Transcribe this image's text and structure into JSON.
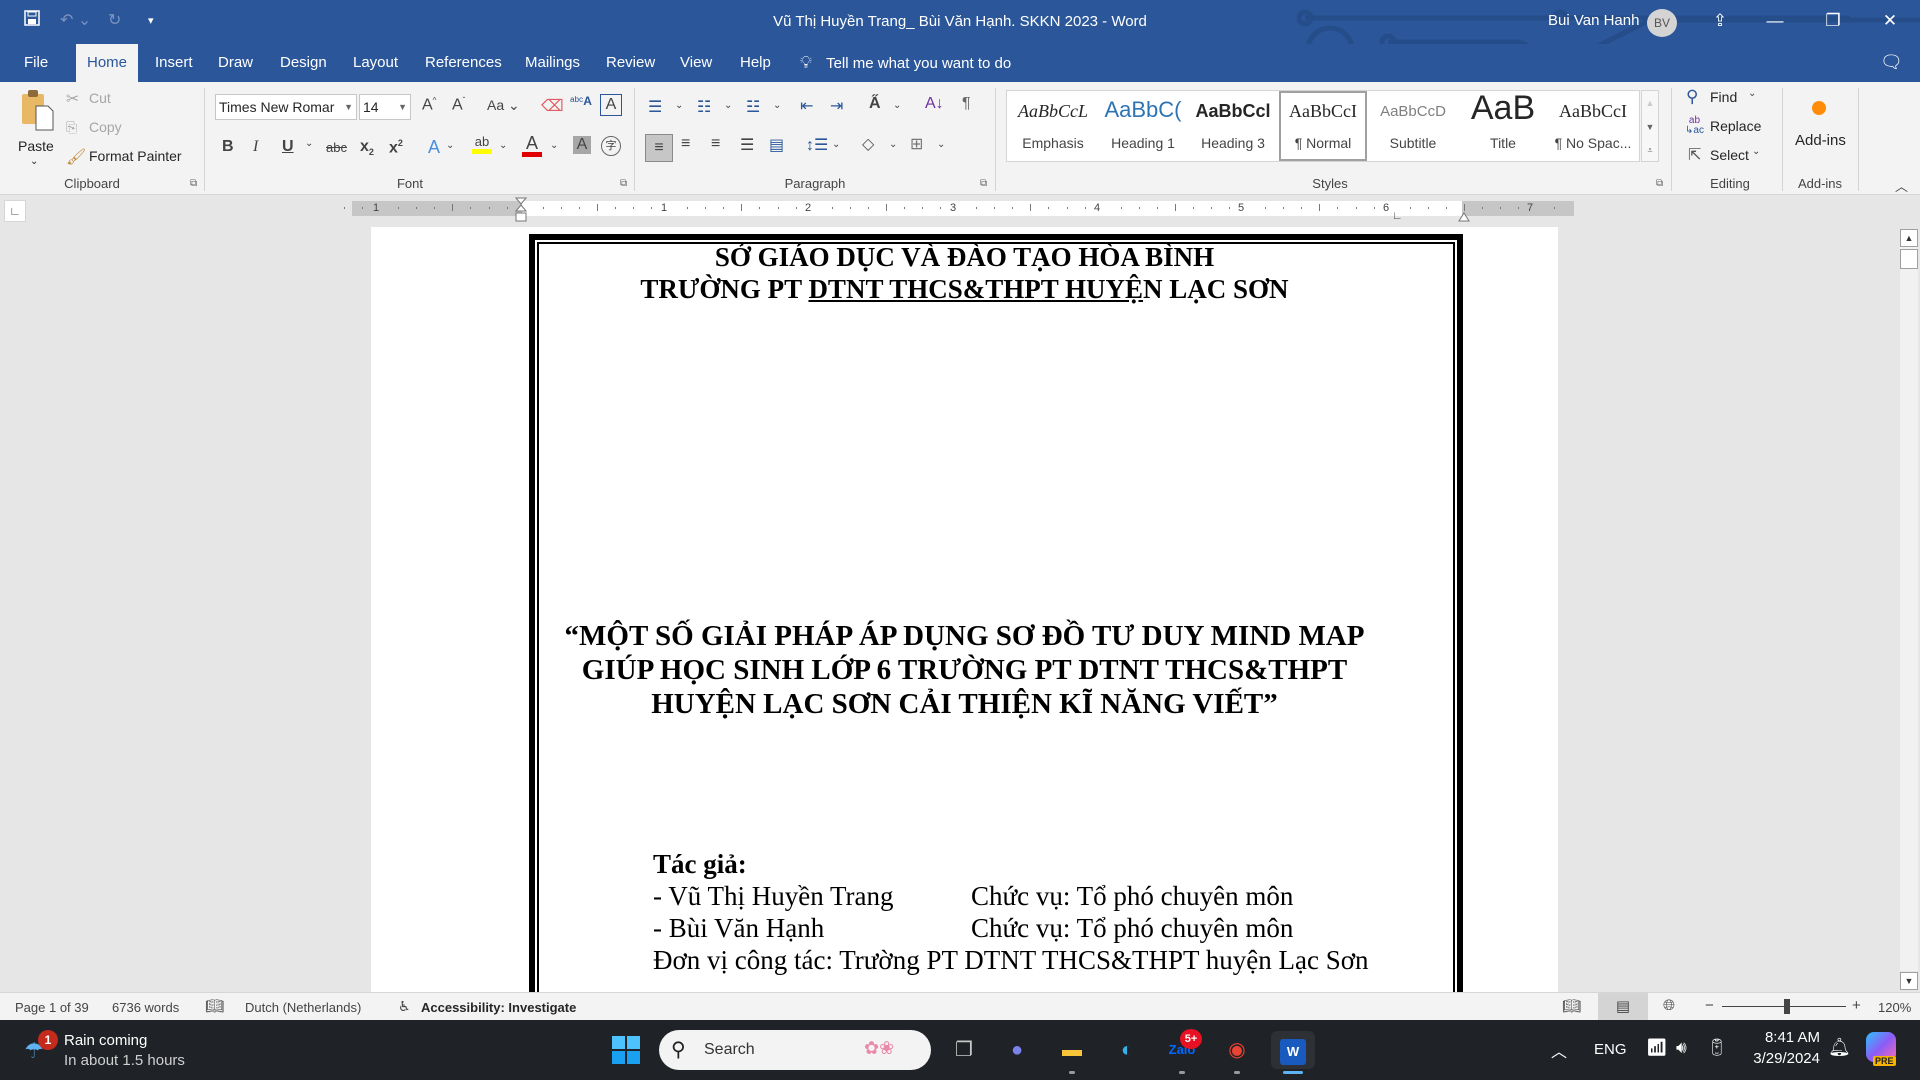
{
  "window": {
    "title": "Vũ Thị Huyền Trang_ Bùi Văn Hạnh. SKKN 2023  -  Word",
    "user_name": "Bui Van Hanh",
    "user_initials": "BV",
    "accent": "#2b579a"
  },
  "qat": {
    "save": "save-icon",
    "undo": "undo-icon",
    "redo": "redo-icon",
    "customize": "customize-icon"
  },
  "tabs": [
    {
      "label": "File"
    },
    {
      "label": "Home"
    },
    {
      "label": "Insert"
    },
    {
      "label": "Draw"
    },
    {
      "label": "Design"
    },
    {
      "label": "Layout"
    },
    {
      "label": "References"
    },
    {
      "label": "Mailings"
    },
    {
      "label": "Review"
    },
    {
      "label": "View"
    },
    {
      "label": "Help"
    }
  ],
  "active_tab": "Home",
  "tell_me": "Tell me what you want to do",
  "ribbon": {
    "clipboard": {
      "paste": "Paste",
      "cut": "Cut",
      "copy": "Copy",
      "format_painter": "Format Painter",
      "label": "Clipboard"
    },
    "font": {
      "name": "Times New Romar",
      "size": "14",
      "change_case": "Aa",
      "label": "Font"
    },
    "paragraph": {
      "label": "Paragraph"
    },
    "styles": {
      "label": "Styles",
      "items": [
        {
          "preview": "AaBbCcL",
          "name": "Emphasis"
        },
        {
          "preview": "AaBbC(",
          "name": "Heading 1"
        },
        {
          "preview": "AaBbCcl",
          "name": "Heading 3"
        },
        {
          "preview": "AaBbCcI",
          "name": "¶ Normal"
        },
        {
          "preview": "AaBbCcD",
          "name": "Subtitle"
        },
        {
          "preview": "AaB",
          "name": "Title"
        },
        {
          "preview": "AaBbCcI",
          "name": "¶ No Spac..."
        }
      ],
      "selected": "¶ Normal"
    },
    "editing": {
      "find": "Find",
      "replace": "Replace",
      "select": "Select",
      "label": "Editing"
    },
    "addins": {
      "button": "Add-ins",
      "label": "Add-ins"
    }
  },
  "ruler": {
    "left_labels": [
      "1"
    ],
    "labels": [
      "1",
      "2",
      "3",
      "4",
      "5",
      "6",
      "7"
    ]
  },
  "document": {
    "header_line1": "SỞ GIÁO DỤC VÀ ĐÀO TẠO HÒA BÌNH",
    "header_line2_pre": "TRƯỜNG PT ",
    "header_line2_under": "DTNT THCS&THPT HUYỆ",
    "header_line2_post": "N LẠC SƠN",
    "title_lines": [
      "“MỘT SỐ GIẢI PHÁP ÁP DỤNG SƠ ĐỒ TƯ DUY MIND MAP",
      "GIÚP HỌC SINH LỚP 6 TRƯỜNG PT DTNT THCS&THPT",
      "HUYỆN LẠC SƠN CẢI THIỆN KĨ NĂNG VIẾT”"
    ],
    "authors_label": "Tác giả:",
    "authors": [
      {
        "name": "- Vũ Thị Huyền Trang",
        "role": "Chức vụ: Tổ phó chuyên môn"
      },
      {
        "name": "- Bùi Văn Hạnh",
        "role": "Chức vụ: Tổ phó chuyên môn"
      }
    ],
    "unit": "Đơn vị công tác: Trường PT DTNT THCS&THPT huyện Lạc Sơn"
  },
  "status": {
    "page": "Page 1 of 39",
    "words": "6736 words",
    "language": "Dutch (Netherlands)",
    "accessibility": "Accessibility: Investigate",
    "zoom": "120%",
    "zoom_level_percent": 120
  },
  "taskbar": {
    "weather_title": "Rain coming",
    "weather_sub": "In about 1.5 hours",
    "weather_badge": "1",
    "search": "Search",
    "zalo_badge": "5+",
    "lang": "ENG",
    "time": "8:41 AM",
    "date": "3/29/2024",
    "copilot_badge": "PRE"
  }
}
